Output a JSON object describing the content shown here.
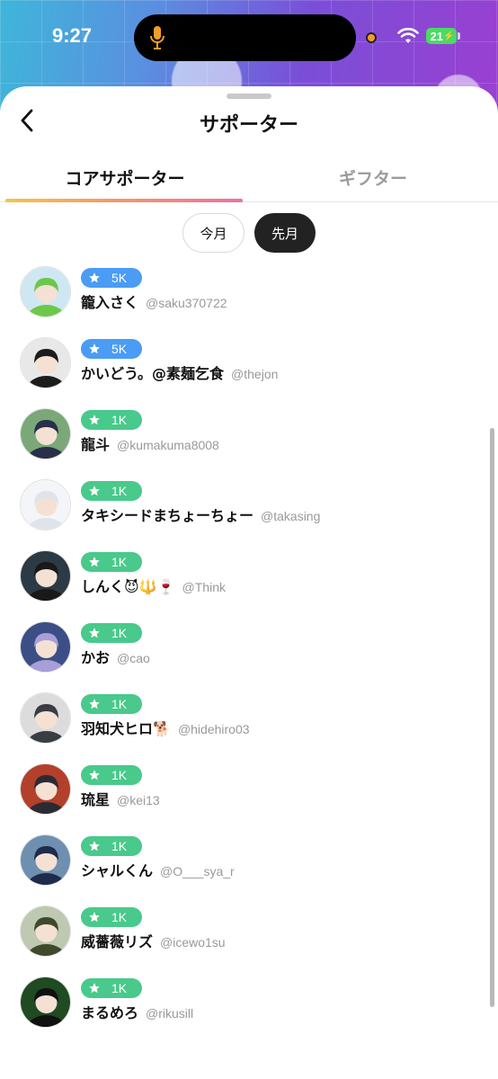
{
  "status_bar": {
    "time": "9:27",
    "battery": "21"
  },
  "header": {
    "title": "サポーター",
    "back_icon": "chevron-left-icon"
  },
  "tabs": [
    {
      "label": "コアサポーター",
      "active": true
    },
    {
      "label": "ギフター",
      "active": false
    }
  ],
  "period_toggle": [
    {
      "label": "今月",
      "selected": false
    },
    {
      "label": "先月",
      "selected": true
    }
  ],
  "colors": {
    "badge_blue": "#4a9cf5",
    "badge_green": "#49c98b",
    "accent_gradient": [
      "#f7c34b",
      "#ee6fa1"
    ]
  },
  "supporters": [
    {
      "badge": "5K",
      "tier": "blue",
      "name": "籠入さく",
      "handle": "@saku370722",
      "avatar_bg": "#cfe7f2",
      "hair": "#6cc84a"
    },
    {
      "badge": "5K",
      "tier": "blue",
      "name": "かいどう。@素麺乞食",
      "handle": "@thejon",
      "avatar_bg": "#e8e8e8",
      "hair": "#1c1c1c"
    },
    {
      "badge": "1K",
      "tier": "green",
      "name": "龍斗",
      "handle": "@kumakuma8008",
      "avatar_bg": "#7aa878",
      "hair": "#2a2f4a"
    },
    {
      "badge": "1K",
      "tier": "green",
      "name": "タキシードまちょーちょー",
      "handle": "@takasing",
      "avatar_bg": "#f3f5f8",
      "hair": "#dfe3ea"
    },
    {
      "badge": "1K",
      "tier": "green",
      "name": "しんく😈🔱🍷",
      "handle": "@Think",
      "avatar_bg": "#2b3a45",
      "hair": "#191919"
    },
    {
      "badge": "1K",
      "tier": "green",
      "name": "かお",
      "handle": "@cao",
      "avatar_bg": "#3b4f86",
      "hair": "#a89fd8"
    },
    {
      "badge": "1K",
      "tier": "green",
      "name": "羽知犬ヒロ🐕",
      "handle": "@hidehiro03",
      "avatar_bg": "#dcdcdc",
      "hair": "#3a3d44"
    },
    {
      "badge": "1K",
      "tier": "green",
      "name": "琉星",
      "handle": "@kei13",
      "avatar_bg": "#b3402b",
      "hair": "#2b2b33"
    },
    {
      "badge": "1K",
      "tier": "green",
      "name": "シャルくん",
      "handle": "@O___sya_r",
      "avatar_bg": "#6f8fb0",
      "hair": "#1f2b4a"
    },
    {
      "badge": "1K",
      "tier": "green",
      "name": "威薔薇リズ",
      "handle": "@icewo1su",
      "avatar_bg": "#bfc8b0",
      "hair": "#3f4a2c"
    },
    {
      "badge": "1K",
      "tier": "green",
      "name": "まるめろ",
      "handle": "@rikusill",
      "avatar_bg": "#1f4a22",
      "hair": "#111111"
    }
  ]
}
